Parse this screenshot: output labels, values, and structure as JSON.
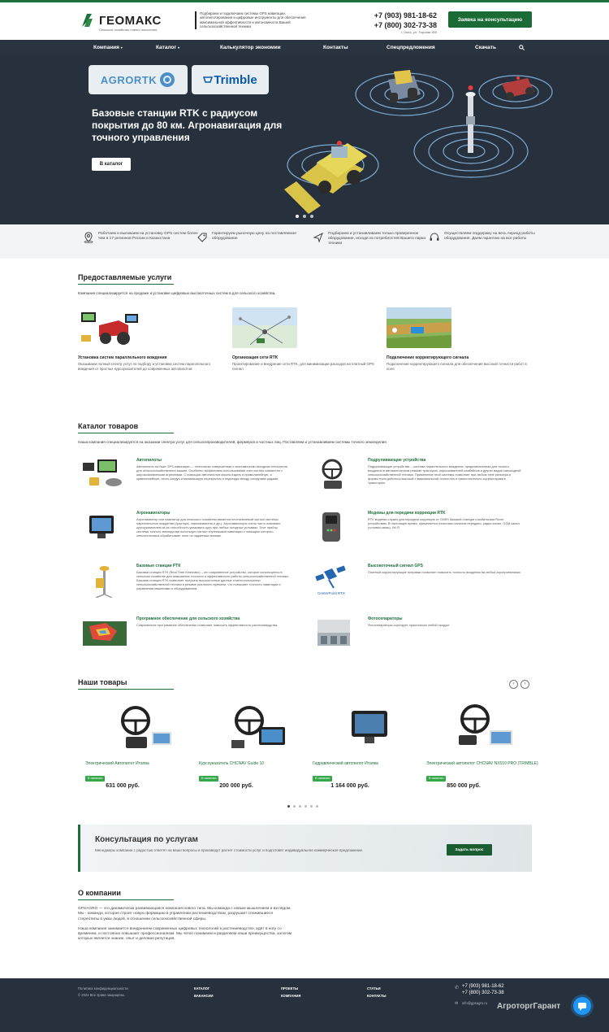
{
  "header": {
    "logo_text": "ГЕОМАКС",
    "logo_sub": "Сельское хозяйство нового поколения",
    "description": "Подбираем и подключаем системы GPS навигации, автопилотирования и цифровые инструменты для обеспечения максимальной эффективности и автономности Вашей сельскохозяйственной техники.",
    "phone_1": "+7 (903) 981-18-62",
    "phone_2": "+7 (800) 302-73-38",
    "address": "г. Омск, ул. Тарская 300",
    "cta_label": "Заявка на консультацию"
  },
  "nav": {
    "items": [
      "Компания",
      "Каталог",
      "Калькулятор экономии",
      "Контакты",
      "Спецпредложения",
      "Скачать"
    ]
  },
  "hero": {
    "brand_1": "AGRORTK",
    "brand_2": "Trimble",
    "title": "Базовые станции RTK с радиусом покрытия до 80 км. Агронавигация для точного управления",
    "button": "В каталог"
  },
  "features": [
    "Работаем и выезжаем на установку GPS систем более чем в 17 регионов России и Казахстана",
    "Гарантируем рыночную цену на поставляемое оборудование",
    "Подбираем и устанавливаем только проверенное оборудование, исходя из потребностей Вашего парка техники",
    "Осуществляем поддержку на весь период работы оборудования. Даем гарантию на все работы"
  ],
  "services": {
    "title": "Предоставляемые услуги",
    "desc": "Компания специализируется на продаже и установке цифровых высокоточных систем в для сельского хозяйства.",
    "items": [
      {
        "title": "Установка систем параллельного вождения",
        "text": "Оказываем полный спектр услуг по подбору и установки систем параллельного вождения от простых курсоуказателей до современных автопилотов"
      },
      {
        "title": "Организация сети RTK",
        "text": "Проектирование и внедрение сети RTK, для минимизации расходов на платный GPS сигнал"
      },
      {
        "title": "Подключение корректирующего сигнала",
        "text": "Подключение корректирующего сигнала для обеспечения высокой точности работ в поле"
      }
    ]
  },
  "catalog": {
    "title": "Каталог товаров",
    "desc": "Наша компания специализируется на оказании спектра услуг для сельхозпроизводителей, фермеров и частных лиц. Поставляем и устанавливаем системы точного земледелия",
    "items": [
      {
        "title": "Автопилоты",
        "text": "Автопилоты на базе GPS-навигации — технически совершенная и экономически выгодная технология для сельскохозяйственных машин. Особенно эффективно использование этих систем совместно с широкозахватными агрегатами. С помощью автопилотов можно ездить в прямолинейную, и криволинейную, легко следуя и минимизируя перекрытия и недоезды между соседними рядами."
      },
      {
        "title": "Подруливающие устройства",
        "text": "Подруливающие устройства – система параллельного вождения, предназначенная для точного вождения в автоматическом режиме тракторов, опрыскивателей комбайнов и других видов самоходной сельскохозяйственной техники. Применение этой системы позволяет при любом типе рельефа и формы поля добиться высокой с максимальной точностью и самостоятельно корректировать траекторию."
      },
      {
        "title": "Агронавигаторы",
        "text": "Агронавигатор или навигатор для сельского хозяйства является неотъемлемой частью системы параллельного вождения (трактора, опрыскивателя и др.). Агронавигаторы очень часто называют курсоуказателем за их способность указывать курс при любых погодных условиях. Этот прибор системы точного земледелия использует сигнал спутниковой навигации с помощью которого сельхозтехника обрабатывает поле по заданным линиям."
      },
      {
        "title": "Модемы для передачи коррекции RTK",
        "text": "RTK модемы служат для передачи коррекции от GNSS базовой станции к мобильным Rover устройствам. В настоящее время, применяется несколько каналов передачи, радио канал, GSM канал (сотовая связь), Wi-Fi."
      },
      {
        "title": "Базовые станции РТК",
        "text": "Базовая станция RTK (Real Time Kinematic) – это современное устройство, которое используется в сельском хозяйстве для повышения точности и эффективности работы сельскохозяйственной техники. Базовая станция RTK позволяет получать высокоточные данные о местоположении сельскохозяйственной техники в режиме реального времени, что повышает точность навигации и управления машинами и оборудованием."
      },
      {
        "title": "Высокоточный сигнал GPS",
        "text": "Платный корректирующие поправки позволяет повысить точность вождения на любых агроприемниках."
      },
      {
        "title": "Програмное обеспечение для сельского хозяйства",
        "text": "Современное программное обеспечение позволяет повысить эффективность растениеводства."
      },
      {
        "title": "Фотосепараторы",
        "text": "Фотосепараторы сортирует практически любой продукт"
      }
    ],
    "centerpoint_label": "CenterPoint RTX"
  },
  "products": {
    "title": "Наши товары",
    "items": [
      {
        "name": "Электрический Автопилот Итагма",
        "badge": "В наличии",
        "price": "631 000 руб."
      },
      {
        "name": "Курсоуказатель CHCNAV Guide 10",
        "badge": "В наличии",
        "price": "200 000 руб."
      },
      {
        "name": "Гидравлический автопилот Итагма",
        "badge": "В наличии",
        "price": "1 164 000 руб."
      },
      {
        "name": "Электрический автопилот CHCNAV NX510 PRO (TRIMBLE)",
        "badge": "В наличии",
        "price": "850 000 руб."
      }
    ],
    "prev": "‹",
    "next": "›"
  },
  "consult": {
    "title": "Консультация по услугам",
    "text": "Менеджеры компании с радостью ответят на ваши вопросы и произведут расчет стоимости услуг и подготовят индивидуальное коммерческое предложение.",
    "button": "Задать вопрос"
  },
  "about": {
    "title": "О компании",
    "p1": "GPSAGRO — это динамически развивающаяся компания нового типа. Мы команда с новым мышлением и взглядом. Мы - команда, которая строит новую формацию в управлении растениеводством, разрушает сложившиеся стереотипы в умах людей, в отношении сельскохозяйственной сферы.",
    "p2": "Наша компания занимается внедрением современных цифровых технологий в растениеводство, идёт в ногу со временем, и постоянно повышает профессионализм. Мы чётко понимаем и разделяем наши преимущества, залогом которых является знание, опыт и деловая репутация."
  },
  "footer": {
    "policy": "Политика конфиденциальности",
    "copyright": "© 2024 Все права защищены.",
    "links": [
      "КАТАЛОГ",
      "ВАКАНСИИ",
      "ПРОЕКТЫ",
      "КОМПАНИЯ",
      "СТАТЬИ",
      "КОНТАКТЫ"
    ],
    "phone_1": "+7 (903) 981-18-62",
    "phone_2": "+7 (800) 302-73-38",
    "email": "info@gpsagro.ru",
    "watermark": "АгроторгГарант"
  },
  "colors": {
    "brand_green": "#1a6b35",
    "dark": "#27313d",
    "chat_blue": "#2196f3"
  }
}
